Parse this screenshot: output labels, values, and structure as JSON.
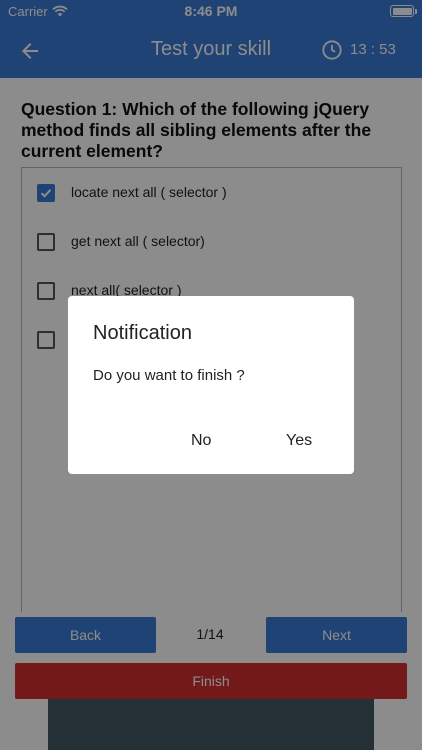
{
  "status_bar": {
    "carrier": "Carrier",
    "time": "8:46 PM"
  },
  "app_bar": {
    "title": "Test your skill",
    "timer": "13 : 53"
  },
  "question": {
    "text": "Question 1: Which of the following jQuery method finds all sibling elements after the current element?"
  },
  "options": [
    {
      "label": "locate next all ( selector )",
      "checked": true
    },
    {
      "label": "get next all ( selector)",
      "checked": false
    },
    {
      "label": "next all( selector )",
      "checked": false
    },
    {
      "label": "",
      "checked": false
    }
  ],
  "navigation": {
    "back_label": "Back",
    "next_label": "Next",
    "page_indicator": "1/14",
    "finish_label": "Finish"
  },
  "dialog": {
    "title": "Notification",
    "message": "Do you want to finish ?",
    "no_label": "No",
    "yes_label": "Yes"
  },
  "colors": {
    "primary": "#3a7bd5",
    "danger": "#d32f2f",
    "footer": "#455a64"
  }
}
